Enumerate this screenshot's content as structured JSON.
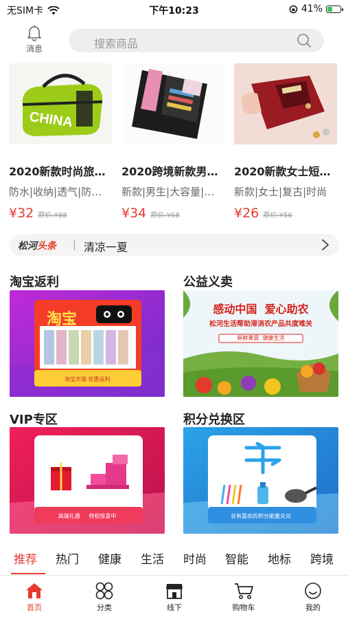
{
  "status_bar": {
    "carrier": "无SIM卡",
    "time": "下午10:23",
    "battery": "41%",
    "battery_level": 0.41
  },
  "header": {
    "message_label": "消息",
    "search_placeholder": "搜索商品"
  },
  "products": [
    {
      "name": "2020新款时尚旅…",
      "tags": "防水|收纳|透气|防…",
      "price": "¥32",
      "original_price": "原价:¥88"
    },
    {
      "name": "2020跨境新款男…",
      "tags": "新款|男生|大容量|…",
      "price": "¥34",
      "original_price": "原价:¥68"
    },
    {
      "name": "2020新款女士短…",
      "tags": "新款|女士|复古|时尚",
      "price": "¥26",
      "original_price": "原价:¥56"
    }
  ],
  "headline": {
    "brand_a": "松河",
    "brand_b": "头条",
    "text": "清凉一夏"
  },
  "sections": [
    {
      "title": "淘宝返利",
      "banner_text": "淘宝",
      "banner_caption": "淘宝天猫 优惠返利"
    },
    {
      "title": "公益义卖",
      "banner_text": "感动中国  爱心助农",
      "banner_sub": "松河生活帮助滞消农产品共度难关",
      "banner_tag": "新鲜果蔬  健康生活"
    },
    {
      "title": "VIP专区",
      "banner_caption": "高端礼遇     特权惊喜中"
    },
    {
      "title": "积分兑换区",
      "banner_caption": "总有喜欢的积分能量兑兑"
    }
  ],
  "categories": [
    "推荐",
    "热门",
    "健康",
    "生活",
    "时尚",
    "智能",
    "地标",
    "跨境"
  ],
  "tabbar": [
    {
      "label": "首页"
    },
    {
      "label": "分类"
    },
    {
      "label": "线下"
    },
    {
      "label": "购物车"
    },
    {
      "label": "我的"
    }
  ],
  "colors": {
    "accent": "#e63b2e",
    "search_bg": "#eeeeee",
    "headline_bg": "#f4f4f4"
  }
}
